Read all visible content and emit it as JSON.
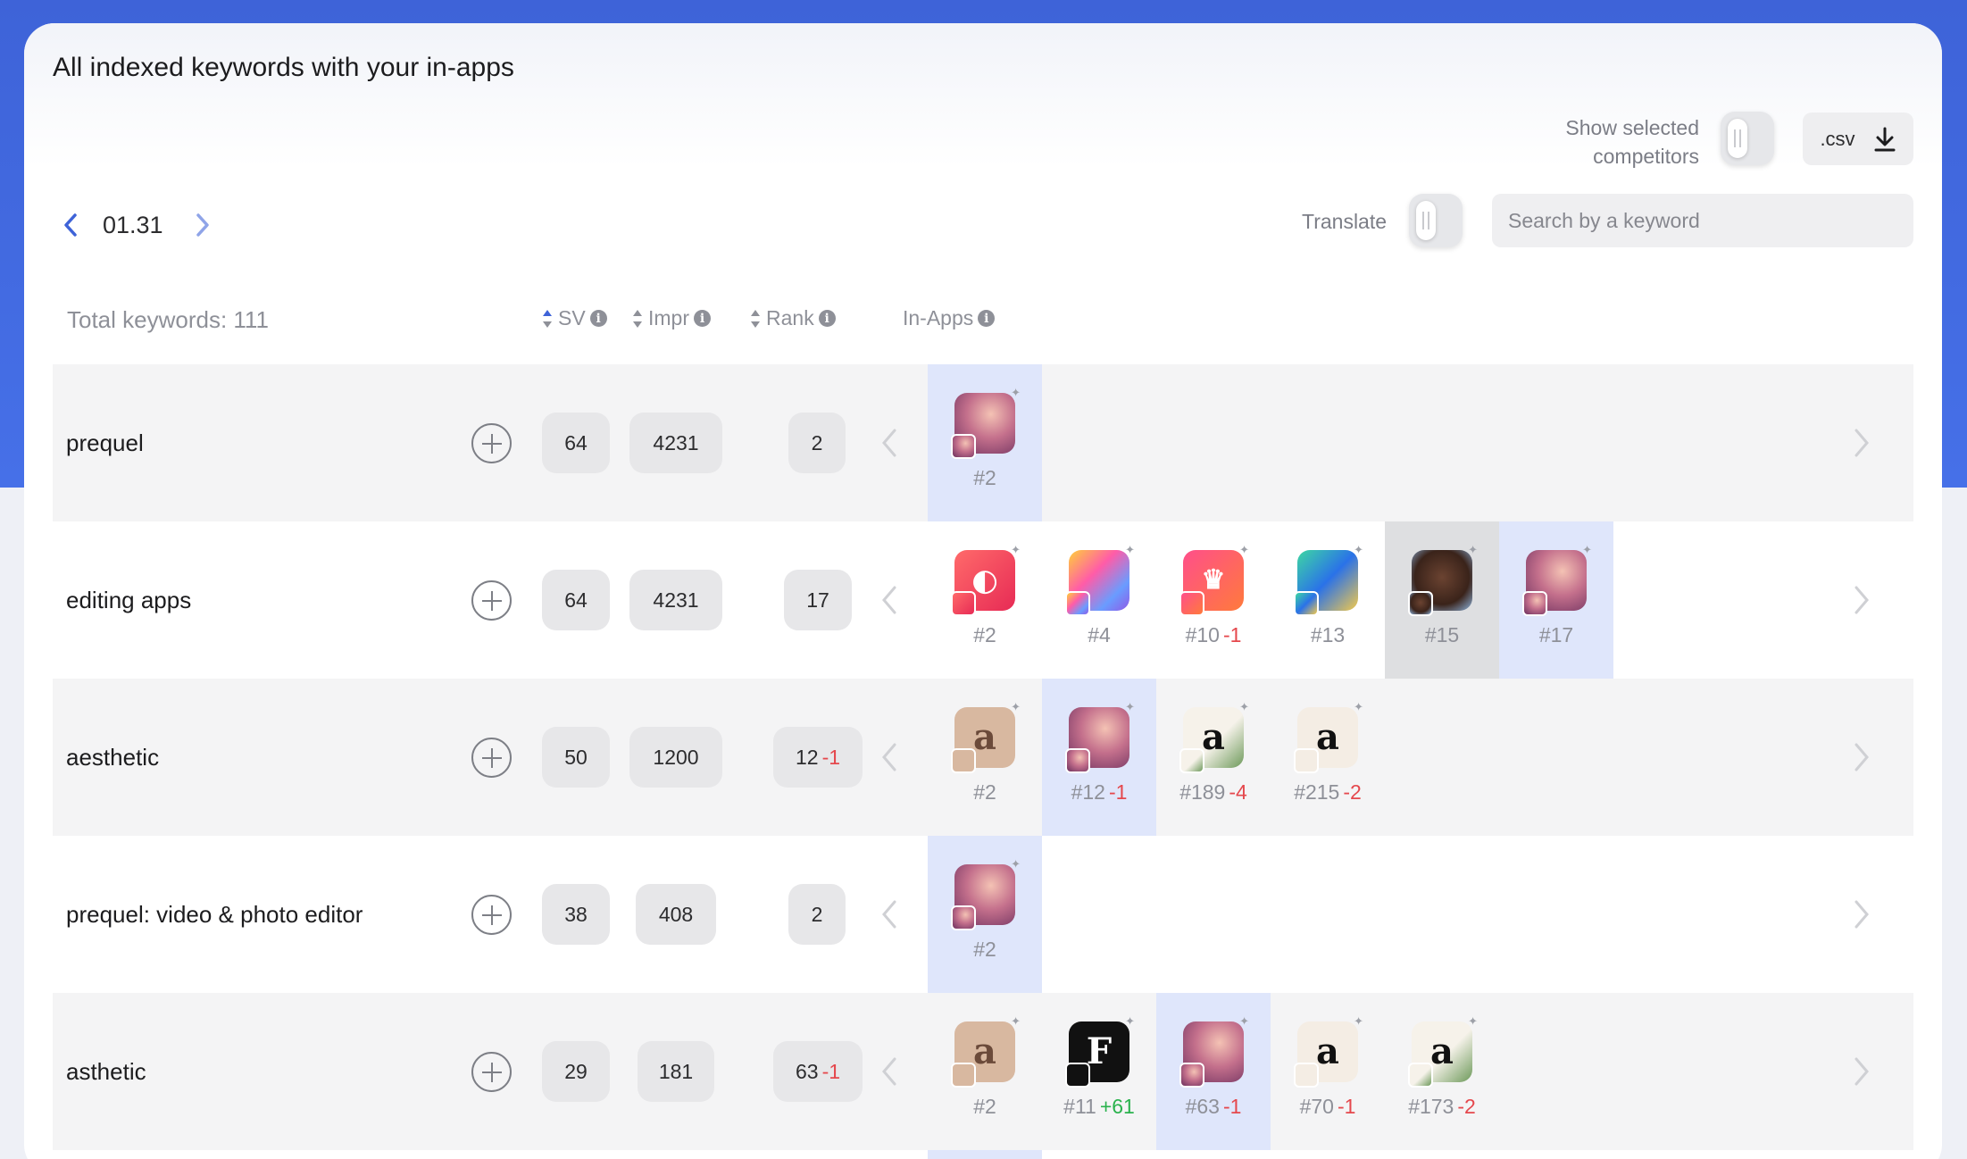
{
  "header": {
    "title": "All indexed keywords with your in-apps",
    "show_selected_label": "Show selected competitors",
    "csv_label": ".csv",
    "date": "01.31",
    "translate_label": "Translate",
    "search_placeholder": "Search by a keyword"
  },
  "columns": {
    "total_keywords": "Total keywords: 111",
    "sv": "SV",
    "impr": "Impr",
    "rank": "Rank",
    "in_apps": "In-Apps"
  },
  "colors": {
    "accent": "#3e63d8",
    "selected_cell": "#dfe6fb",
    "negative": "#e5484d",
    "positive": "#2ab24d"
  },
  "rows": [
    {
      "keyword": "prequel",
      "sv": "64",
      "impr": "4231",
      "rank": "2",
      "rank_delta": "",
      "apps": [
        {
          "rank": "#2",
          "delta": "",
          "icon": "prequel-app-icon",
          "selected": "blue"
        }
      ]
    },
    {
      "keyword": "editing apps",
      "sv": "64",
      "impr": "4231",
      "rank": "17",
      "rank_delta": "",
      "apps": [
        {
          "rank": "#2",
          "delta": "",
          "icon": "pink-editor-app-icon",
          "selected": ""
        },
        {
          "rank": "#4",
          "delta": "",
          "icon": "colorful-portrait-app-icon",
          "selected": ""
        },
        {
          "rank": "#10",
          "delta": "-1",
          "icon": "crown-app-icon",
          "selected": ""
        },
        {
          "rank": "#13",
          "delta": "",
          "icon": "fita-pro-app-icon",
          "selected": ""
        },
        {
          "rank": "#15",
          "delta": "",
          "icon": "face-app-icon",
          "selected": "gray"
        },
        {
          "rank": "#17",
          "delta": "",
          "icon": "prequel-app-icon",
          "selected": "blue"
        }
      ]
    },
    {
      "keyword": "aesthetic",
      "sv": "50",
      "impr": "1200",
      "rank": "12",
      "rank_delta": "-1",
      "apps": [
        {
          "rank": "#2",
          "delta": "",
          "icon": "aesthetic-crown-app-icon",
          "selected": ""
        },
        {
          "rank": "#12",
          "delta": "-1",
          "icon": "prequel-app-icon",
          "selected": "blue"
        },
        {
          "rank": "#189",
          "delta": "-4",
          "icon": "aesthetic-leaf-app-icon",
          "selected": ""
        },
        {
          "rank": "#215",
          "delta": "-2",
          "icon": "aesthetic-cream-app-icon",
          "selected": ""
        }
      ]
    },
    {
      "keyword": "prequel: video & photo editor",
      "sv": "38",
      "impr": "408",
      "rank": "2",
      "rank_delta": "",
      "apps": [
        {
          "rank": "#2",
          "delta": "",
          "icon": "prequel-app-icon",
          "selected": "blue"
        }
      ]
    },
    {
      "keyword": "asthetic",
      "sv": "29",
      "impr": "181",
      "rank": "63",
      "rank_delta": "-1",
      "apps": [
        {
          "rank": "#2",
          "delta": "",
          "icon": "aesthetic-crown-app-icon",
          "selected": ""
        },
        {
          "rank": "#11",
          "delta": "+61",
          "icon": "black-f-app-icon",
          "selected": ""
        },
        {
          "rank": "#63",
          "delta": "-1",
          "icon": "prequel-app-icon",
          "selected": "blue"
        },
        {
          "rank": "#70",
          "delta": "-1",
          "icon": "aesthetic-cream-app-icon",
          "selected": ""
        },
        {
          "rank": "#173",
          "delta": "-2",
          "icon": "aesthetic-leaf-app-icon",
          "selected": ""
        }
      ]
    }
  ]
}
